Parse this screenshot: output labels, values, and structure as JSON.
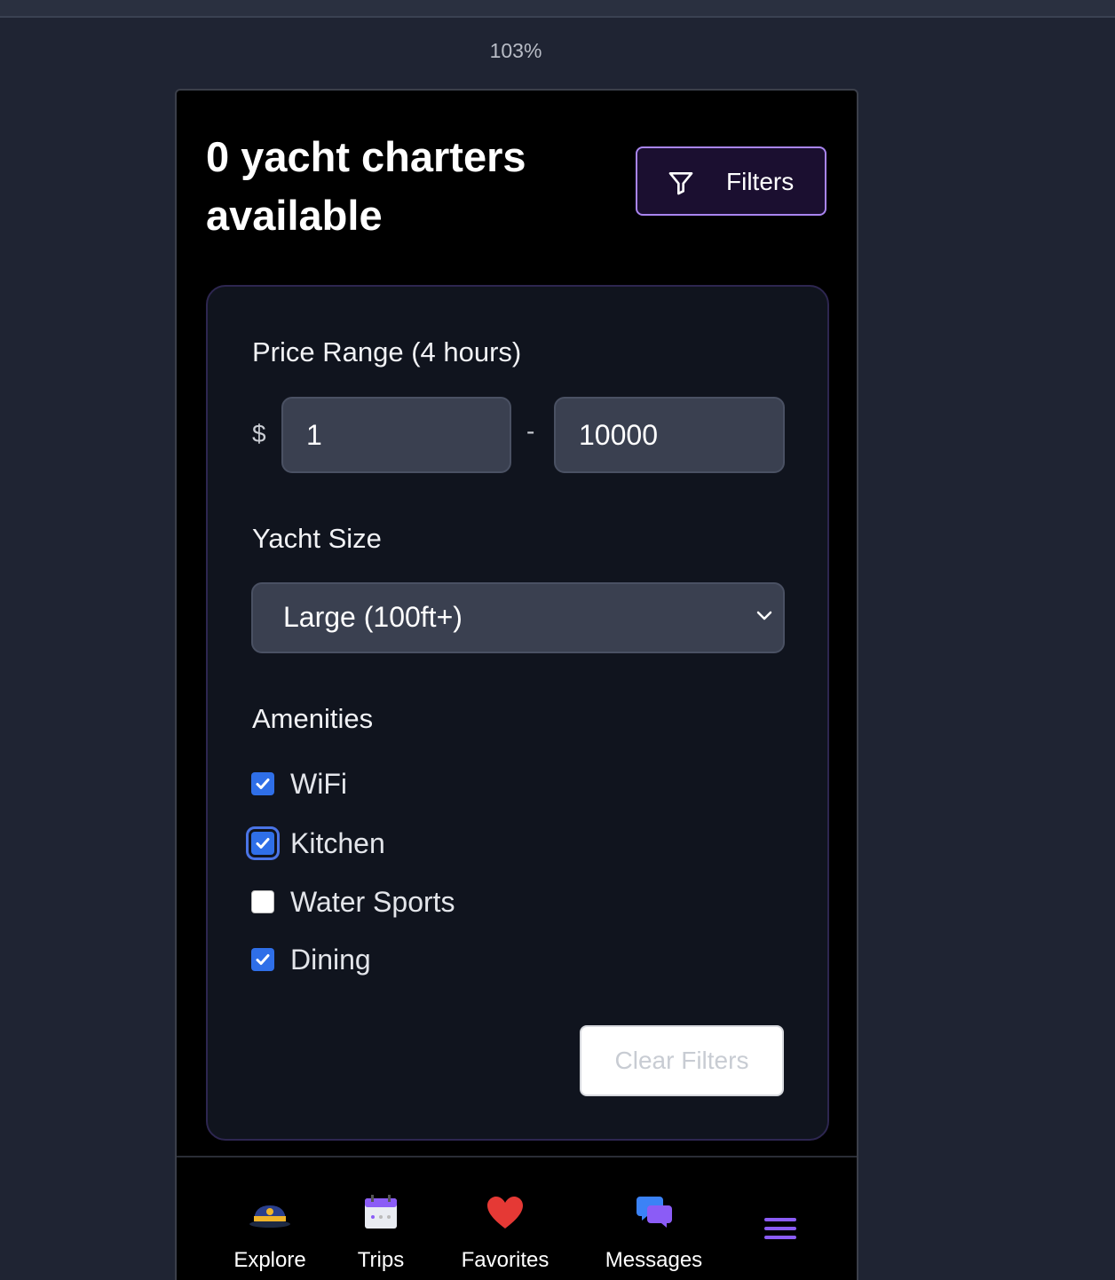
{
  "browser": {
    "zoom": "103%"
  },
  "header": {
    "title": "0 yacht charters available",
    "filters_label": "Filters"
  },
  "filters": {
    "price": {
      "label": "Price Range (4 hours)",
      "currency": "$",
      "min": "1",
      "separator": "-",
      "max": "10000"
    },
    "size": {
      "label": "Yacht Size",
      "selected": "Large (100ft+)"
    },
    "amenities": {
      "label": "Amenities",
      "items": [
        {
          "label": "WiFi",
          "checked": true
        },
        {
          "label": "Kitchen",
          "checked": true
        },
        {
          "label": "Water Sports",
          "checked": false
        },
        {
          "label": "Dining",
          "checked": true
        }
      ]
    },
    "clear_label": "Clear Filters"
  },
  "nav": {
    "items": [
      {
        "label": "Explore",
        "icon": "captain-hat-icon"
      },
      {
        "label": "Trips",
        "icon": "calendar-icon"
      },
      {
        "label": "Favorites",
        "icon": "heart-icon"
      },
      {
        "label": "Messages",
        "icon": "chat-bubbles-icon"
      },
      {
        "label": "",
        "icon": "menu-icon"
      }
    ]
  },
  "colors": {
    "accent": "#a985f0",
    "checkbox": "#2f6fe8",
    "panel": "#10141e",
    "input": "#3a4050"
  }
}
